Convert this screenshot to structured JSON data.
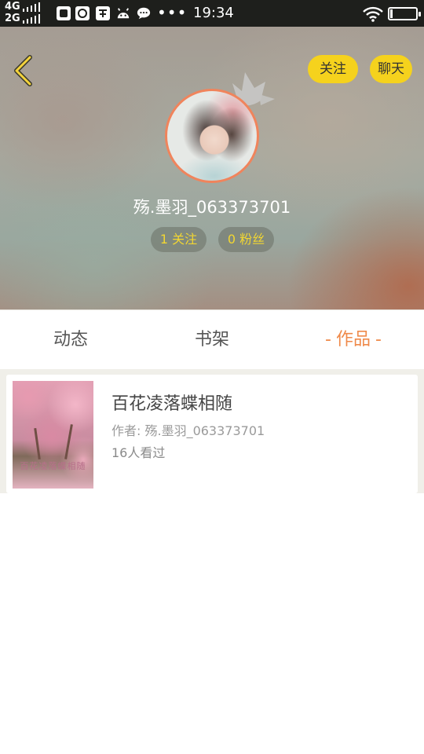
{
  "status_bar": {
    "network_top": "4G",
    "network_bottom": "2G",
    "more": "•••",
    "time": "19:34"
  },
  "header": {
    "follow_label": "关注",
    "chat_label": "聊天",
    "username": "殇.墨羽_063373701",
    "following_count": "1 关注",
    "fans_count": "0 粉丝"
  },
  "tabs": [
    {
      "label": "动态"
    },
    {
      "label": "书架"
    },
    {
      "label": "作品",
      "active": true,
      "dash": "-"
    }
  ],
  "works": [
    {
      "title": "百花凌落蝶相随",
      "author": "作者: 殇.墨羽_063373701",
      "views": "16人看过",
      "cover_text": "百花凌落蝶相随"
    }
  ],
  "colors": {
    "accent_yellow": "#f5d21d",
    "active_tab": "#ef8a4a",
    "avatar_ring": "#f0845c"
  }
}
